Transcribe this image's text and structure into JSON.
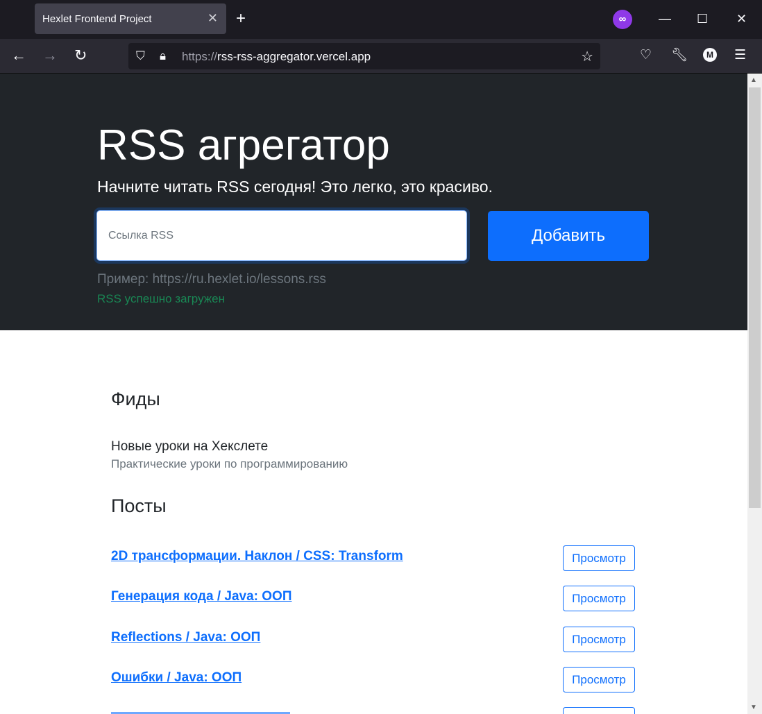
{
  "browser": {
    "tab_title": "Hexlet Frontend Project",
    "tab_close": "✕",
    "new_tab": "+",
    "url_scheme": "https://",
    "url_host": "rss-rss-aggregator.vercel.app"
  },
  "hero": {
    "title": "RSS агрегатор",
    "lead": "Начните читать RSS сегодня! Это легко, это красиво.",
    "input_placeholder": "Ссылка RSS",
    "add_label": "Добавить",
    "example": "Пример: https://ru.hexlet.io/lessons.rss",
    "feedback": "RSS успешно загружен",
    "feedback_color": "#198754",
    "accent": "#0d6efd"
  },
  "feeds": {
    "heading": "Фиды",
    "items": [
      {
        "title": "Новые уроки на Хекслете",
        "description": "Практические уроки по программированию"
      }
    ]
  },
  "posts": {
    "heading": "Посты",
    "view_label": "Просмотр",
    "items": [
      {
        "title": "2D трансформации. Наклон / CSS: Transform"
      },
      {
        "title": "Генерация кода / Java: ООП"
      },
      {
        "title": "Reflections / Java: ООП"
      },
      {
        "title": "Ошибки / Java: ООП"
      }
    ]
  }
}
